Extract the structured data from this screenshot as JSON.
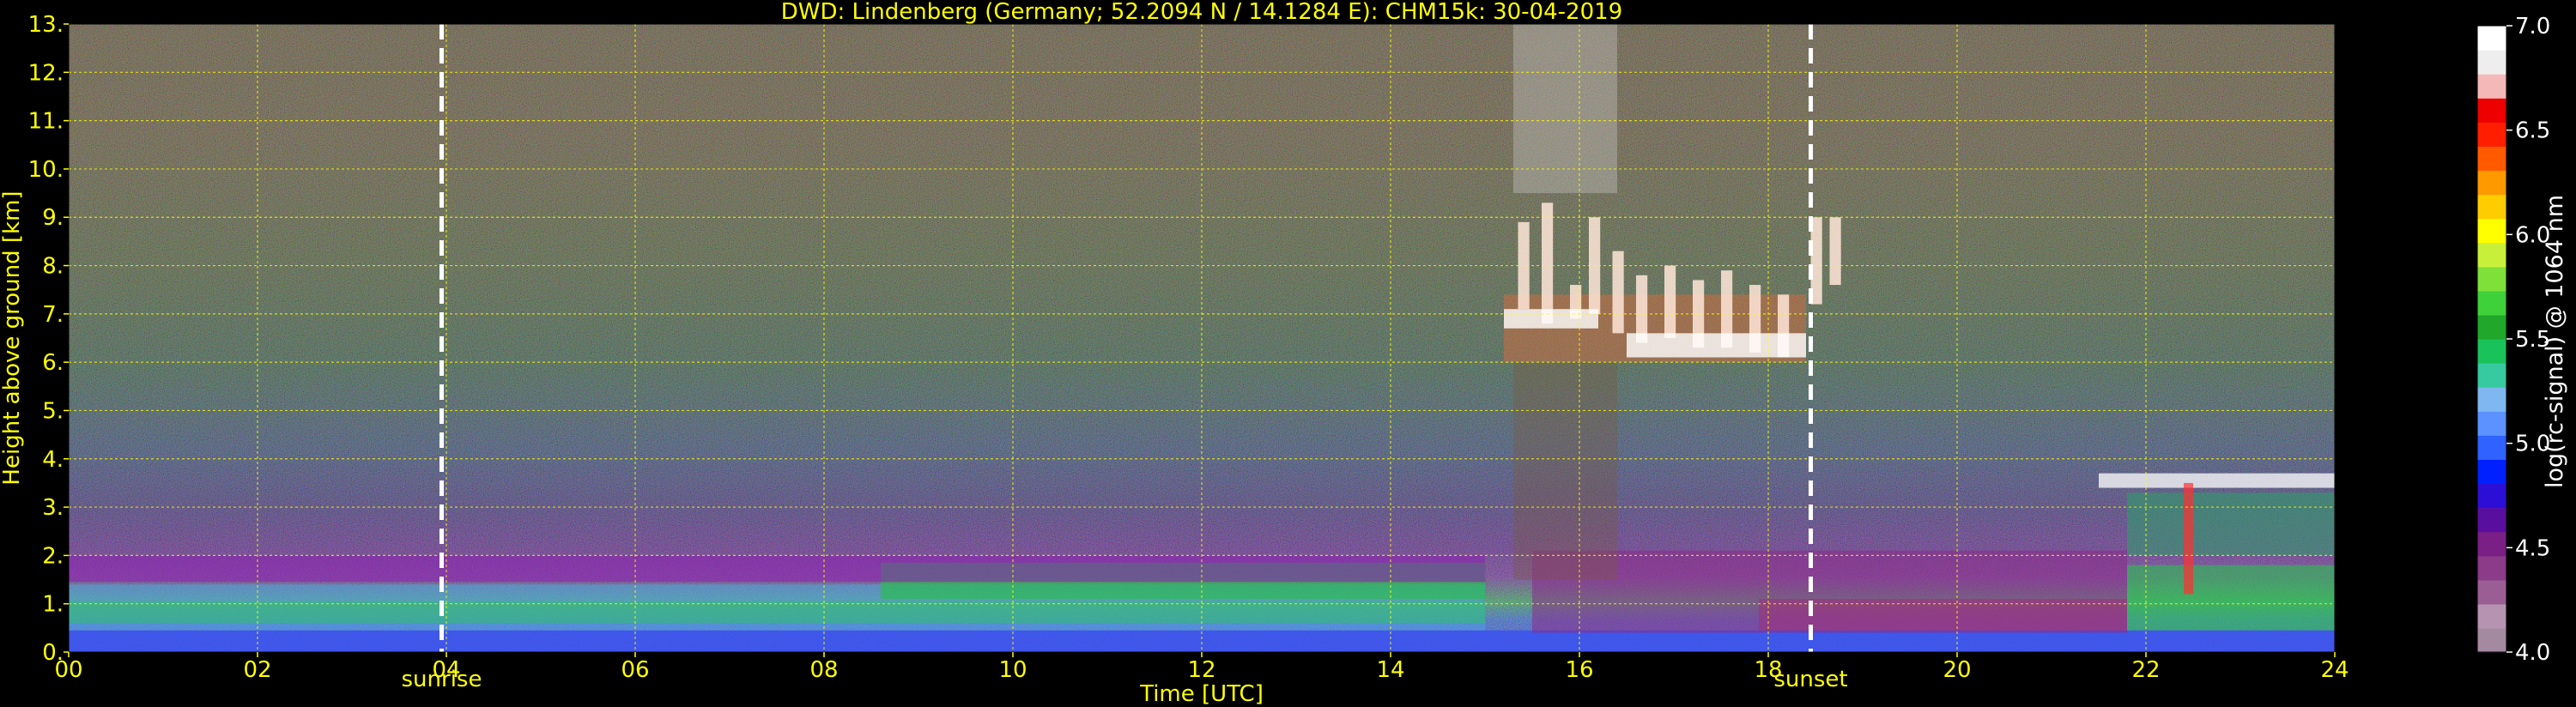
{
  "chart_data": {
    "type": "heatmap",
    "title": "DWD: Lindenberg (Germany; 52.2094 N / 14.1284 E):    CHM15k: 30-04-2019",
    "xlabel": "Time [UTC]",
    "ylabel": "Height above ground [km]",
    "xlim": [
      0,
      24
    ],
    "ylim": [
      0,
      13
    ],
    "x_ticks": [
      0,
      2,
      4,
      6,
      8,
      10,
      12,
      14,
      16,
      18,
      20,
      22,
      24
    ],
    "x_tick_labels": [
      "00",
      "02",
      "04",
      "06",
      "08",
      "10",
      "12",
      "14",
      "16",
      "18",
      "20",
      "22",
      "24"
    ],
    "y_ticks": [
      0,
      1,
      2,
      3,
      4,
      5,
      6,
      7,
      8,
      9,
      10,
      11,
      12,
      13
    ],
    "y_tick_labels": [
      "0.",
      "1.",
      "2.",
      "3.",
      "4.",
      "5.",
      "6.",
      "7.",
      "8.",
      "9.",
      "10.",
      "11.",
      "12.",
      "13."
    ],
    "grid": true,
    "grid_color": "#ffff00",
    "annotations": [
      {
        "label": "sunrise",
        "x": 3.95
      },
      {
        "label": "sunset",
        "x": 18.45
      }
    ],
    "colorbar": {
      "label": "log(rc-signal) @ 1064 nm",
      "range": [
        4.0,
        7.0
      ],
      "ticks": [
        4.0,
        4.5,
        5.0,
        5.5,
        6.0,
        6.5,
        7.0
      ],
      "tick_labels": [
        "4.0",
        "4.5",
        "5.0",
        "5.5",
        "6.0",
        "6.5",
        "7.0"
      ],
      "colors": [
        "#a48aa0",
        "#b593b1",
        "#9b5e94",
        "#8c3a8a",
        "#7a1f86",
        "#5a0ea0",
        "#2c0fd6",
        "#0020ff",
        "#2f62ff",
        "#5b92ff",
        "#7fb8f0",
        "#37c9a0",
        "#19c35a",
        "#21a82b",
        "#3ed13a",
        "#7fe03a",
        "#c8f03a",
        "#ffff00",
        "#ffcc00",
        "#ff9900",
        "#ff5a00",
        "#ff1e00",
        "#ee0000",
        "#f4b8b8",
        "#eeeeee",
        "#ffffff"
      ]
    },
    "features": [
      {
        "type": "boundary layer",
        "x_range": [
          0,
          24
        ],
        "y_range": [
          0,
          2
        ]
      },
      {
        "type": "cirrus cloud",
        "x_range": [
          15.2,
          18.7
        ],
        "y_range": [
          6,
          9.5
        ]
      },
      {
        "type": "cloud",
        "x_range": [
          21.5,
          24
        ],
        "y_range": [
          2,
          3.7
        ]
      }
    ]
  }
}
